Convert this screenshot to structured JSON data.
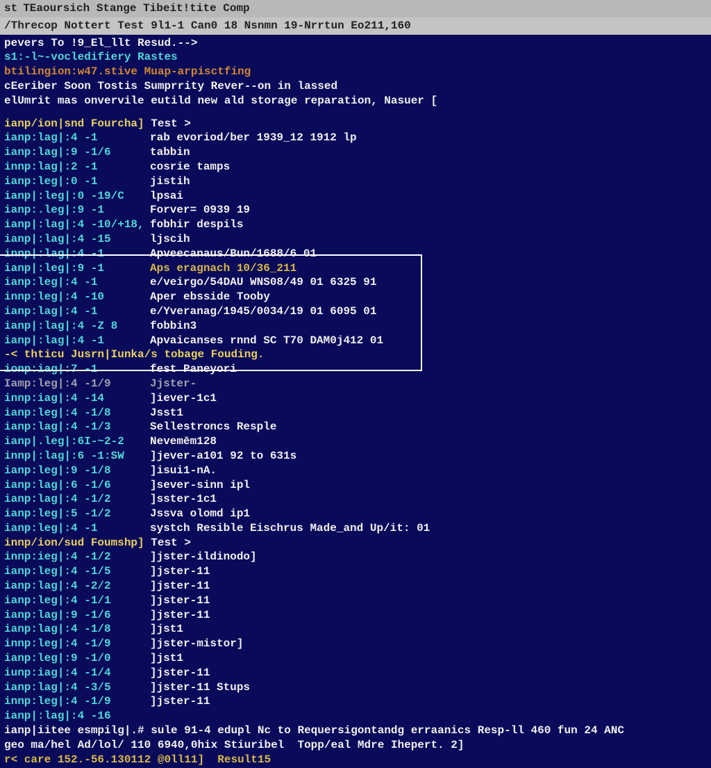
{
  "titlebar": {
    "prefix": "st",
    "title": "TEaoursich Stange Tibeit!tite Comp"
  },
  "menubar": "/Threcop Nottert Test 9l1-1 Can0 18 Nsnmn 19-Nrrtun Eo211,160",
  "header_lines": [
    {
      "text": "pevers To !9_El_llt Resud.-->",
      "cls": "c-white"
    },
    {
      "text": "s1:-l~-vocledifiery Rastes",
      "cls": "c-cyan"
    },
    {
      "text": "btilingion:w47.stive Muap-arpisctfing",
      "cls": "c-orange"
    },
    {
      "text": "cEeriber Soon Tostis Sumprrity Rever--on in lassed",
      "cls": "c-white"
    },
    {
      "text": "elUmrit mas onvervile eutild new ald storage reparation, Nasuer [",
      "cls": "c-white"
    }
  ],
  "section1_header": {
    "prefix": "ianp/ion|snd Fourcha]",
    "rest": " Test >"
  },
  "section1_rows": [
    {
      "prefix": "ianp:lag|:4 -1",
      "rest": "rab evoriod/ber 1939_12 1912 lp"
    },
    {
      "prefix": "ianp:lag|:9 -1/6",
      "rest": "tabbin"
    },
    {
      "prefix": "innp:lag|:2 -1",
      "rest": "cosrie tamps"
    },
    {
      "prefix": "ianp:leg|:0 -1",
      "rest": "jistih"
    },
    {
      "prefix": "ianp|:leg|:0 -19/C",
      "rest": "lpsai"
    },
    {
      "prefix": "ianp:.leg|:9 -1",
      "rest": "Forver= 0939 19"
    },
    {
      "prefix": "ianp|:lag|:4 -10/+18,",
      "rest": "fobhir despils"
    },
    {
      "prefix": "ianp|:lag|:4 -15",
      "rest": "ljscih"
    },
    {
      "prefix": "innp|:lag|:4 -1",
      "rest": "Apveecanaus/Bun/1688/6 01"
    }
  ],
  "highlight_rows": [
    {
      "prefix": "ianp|:leg|:9 -1",
      "rest": "Aps eragnach 10/36_211",
      "cls": "c-gold"
    },
    {
      "prefix": "ianp:leg|:4 -1",
      "rest": "e/veirgo/54DAU WNS08/49 01 6325 91",
      "cls": "c-white"
    },
    {
      "prefix": "innp:leg|:4 -10",
      "rest": "Aper ebsside Tooby",
      "cls": "c-white"
    },
    {
      "prefix": "ianp:lag|:4 -1",
      "rest": "e/Yveranag/1945/0034/19 01 6095 01",
      "cls": "c-white"
    },
    {
      "prefix": "ianp|:lag|:4 -Z 8",
      "rest": "fobbin3",
      "cls": "c-white"
    },
    {
      "prefix": "ianp|:lag|:4 -1",
      "rest": "Apvaicanses rnnd SC T70 DAM0j412 01",
      "cls": "c-white"
    }
  ],
  "highlight_status": "-< thticu Jusrn|Iunka/s tobage Fouding.",
  "highlight_trailing": {
    "prefix": "ionp:iag|:7 -1",
    "rest": "fest Paneyori"
  },
  "section2_rows": [
    {
      "prefix": "Iamp:leg|:4 -1/9",
      "rest": "Jjster-",
      "cls": "c-dim"
    },
    {
      "prefix": "innp:iag|:4 -14",
      "rest": "]iever-1c1"
    },
    {
      "prefix": "ianp:leg|:4 -1/8",
      "rest": "Jsst1"
    },
    {
      "prefix": "ianp:lag|:4 -1/3",
      "rest": "Sellestroncs Resple"
    },
    {
      "prefix": "ianp|.leg|:6I-~2-2",
      "rest": "Nevemēm128"
    },
    {
      "prefix": "innp|:lag|:6 -1:SW",
      "rest": "]jever-a101 92 to 631s"
    },
    {
      "prefix": "ianp:leg|:9 -1/8",
      "rest": "]isui1-nA."
    },
    {
      "prefix": "ianp:lag|:6 -1/6",
      "rest": "]sever-sinn ipl"
    },
    {
      "prefix": "ianp:lag|:4 -1/2",
      "rest": "]sster-1c1"
    },
    {
      "prefix": "ianp:leg|:5 -1/2",
      "rest": "Jssva olomd ip1"
    },
    {
      "prefix": "ianp:leg|:4 -1",
      "rest": "systch Resible Eischrus Made_and Up/it: 01"
    }
  ],
  "section3_header": {
    "prefix": "innp/ion/sud Foumshp]",
    "rest": " Test >"
  },
  "section3_rows": [
    {
      "prefix": "innp:ieg|:4 -1/2",
      "rest": "]jster-ildinodo]"
    },
    {
      "prefix": "ianp:leg|:4 -1/5",
      "rest": "]jster-11"
    },
    {
      "prefix": "ianp:lag|:4 -2/2",
      "rest": "]jster-11"
    },
    {
      "prefix": "ianp:leg|:4 -1/1",
      "rest": "]jster-11"
    },
    {
      "prefix": "ianp:lag|:9 -1/6",
      "rest": "]jster-11"
    },
    {
      "prefix": "ianp:lag|:4 -1/8",
      "rest": "]jst1"
    },
    {
      "prefix": "innp:leg|:4 -1/9",
      "rest": "]jster-mistor]"
    },
    {
      "prefix": "ianp:leg|:9 -1/0",
      "rest": "]jst1"
    },
    {
      "prefix": "iunp:iag|:4 -1/4",
      "rest": "]jster-11"
    },
    {
      "prefix": "ianp:lag|:4 -3/5",
      "rest": "]jster-11 Stups"
    },
    {
      "prefix": "innp:leg|:4 -1/9",
      "rest": "]jster-11"
    },
    {
      "prefix": "ianp|:lag|:4 -16",
      "rest": ""
    }
  ],
  "footer_lines": [
    {
      "text": "ianp|iitee esmpilg|.# sule 91-4 edupl Nc to Requersigontandg erraanics Resp-ll 460 fun 24 ANC",
      "cls": "c-white"
    },
    {
      "text": "geo ma/hel Ad/lol/ 110 6940,0hix Stiuribel  Topp/eal Mdre Ihepert. 2]",
      "cls": "c-white"
    },
    {
      "text": "r< care 152.-56.130112 @0ll11]  Result15",
      "cls": "c-gold"
    }
  ]
}
